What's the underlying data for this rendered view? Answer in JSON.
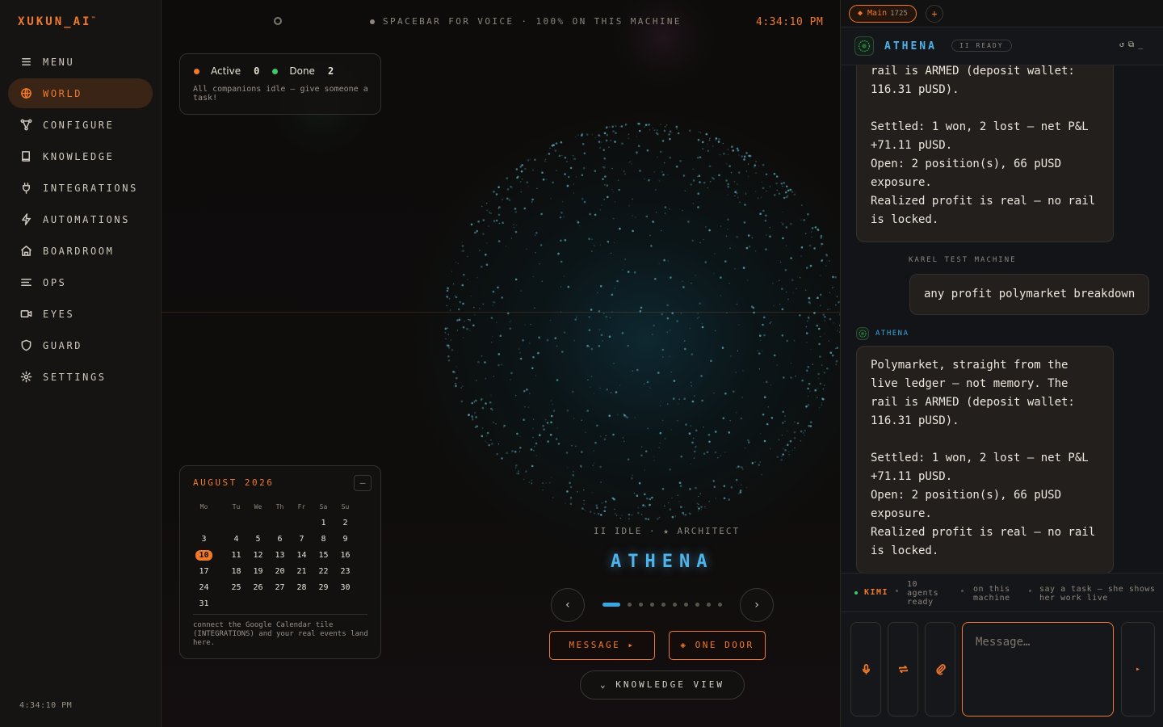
{
  "app": {
    "logo": "XUKUN_AI",
    "logo_mark": "™"
  },
  "sidebar": {
    "items": [
      {
        "label": "MENU",
        "icon": "menu-icon"
      },
      {
        "label": "WORLD",
        "icon": "globe-icon",
        "active": true
      },
      {
        "label": "CONFIGURE",
        "icon": "nodes-icon"
      },
      {
        "label": "KNOWLEDGE",
        "icon": "book-icon"
      },
      {
        "label": "INTEGRATIONS",
        "icon": "plug-icon"
      },
      {
        "label": "AUTOMATIONS",
        "icon": "bolt-icon"
      },
      {
        "label": "BOARDROOM",
        "icon": "building-icon"
      },
      {
        "label": "OPS",
        "icon": "list-icon"
      },
      {
        "label": "EYES",
        "icon": "camera-icon"
      },
      {
        "label": "GUARD",
        "icon": "shield-icon"
      },
      {
        "label": "SETTINGS",
        "icon": "gear-icon"
      }
    ],
    "clock": "4:34:10 PM"
  },
  "world": {
    "hint": "SPACEBAR FOR VOICE · 100% ON THIS MACHINE",
    "clock": "4:34:10 PM",
    "status": {
      "active_label": "Active",
      "active_count": "0",
      "done_label": "Done",
      "done_count": "2",
      "note": "All companions idle — give someone a task!"
    },
    "calendar": {
      "title": "AUGUST 2026",
      "collapse": "–",
      "weekdays": [
        "Mo",
        "Tu",
        "We",
        "Th",
        "Fr",
        "Sa",
        "Su"
      ],
      "weeks": [
        [
          "",
          "",
          "",
          "",
          "",
          "1",
          "2"
        ],
        [
          "3",
          "4",
          "5",
          "6",
          "7",
          "8",
          "9"
        ],
        [
          "10",
          "11",
          "12",
          "13",
          "14",
          "15",
          "16"
        ],
        [
          "17",
          "18",
          "19",
          "20",
          "21",
          "22",
          "23"
        ],
        [
          "24",
          "25",
          "26",
          "27",
          "28",
          "29",
          "30"
        ],
        [
          "31",
          "",
          "",
          "",
          "",
          "",
          ""
        ]
      ],
      "today": "10",
      "note": "connect the Google Calendar tile (INTEGRATIONS) and your real events land here."
    },
    "agent": {
      "status": "II IDLE · ★ ARCHITECT",
      "name": "ATHENA"
    },
    "pager": {
      "prev": "‹",
      "next": "›",
      "pages": 10,
      "current": 1
    },
    "buttons": {
      "message": "MESSAGE ▸",
      "one_door": "◈ ONE DOOR",
      "knowledge": "⌄   KNOWLEDGE VIEW"
    }
  },
  "chat": {
    "tab": {
      "label": "◆ Main",
      "count": "1725",
      "add": "+"
    },
    "header": {
      "name": "ATHENA",
      "badge": "II READY",
      "icons": [
        "↺",
        "⧉",
        "_"
      ]
    },
    "messages": [
      {
        "role": "agent",
        "text": "rail is ARMED (deposit wallet:\n116.31 pUSD).\n\nSettled: 1 won, 2 lost — net P&L\n+71.11 pUSD.\nOpen: 2 position(s), 66 pUSD\nexposure.\nRealized profit is real — no rail\nis locked."
      },
      {
        "role": "user",
        "sender": "KAREL TEST MACHINE",
        "text": "any profit polymarket breakdown"
      },
      {
        "role": "agent",
        "sender": "ATHENA",
        "text": "Polymarket, straight from the\nlive ledger — not memory. The\nrail is ARMED (deposit wallet:\n116.31 pUSD).\n\nSettled: 1 won, 2 lost — net P&L\n+71.11 pUSD.\nOpen: 2 position(s), 66 pUSD\nexposure.\nRealized profit is real — no rail\nis locked."
      }
    ],
    "statusbar": {
      "model": "KIMI",
      "agents": "10 agents ready",
      "machine": "on this machine",
      "tip": "say a task — she shows her work live"
    },
    "composer": {
      "placeholder": "Message…",
      "send": "▸"
    }
  },
  "colors": {
    "accent": "#f07a2a",
    "agent_blue": "#4db3ea",
    "done_green": "#3fc86a"
  }
}
